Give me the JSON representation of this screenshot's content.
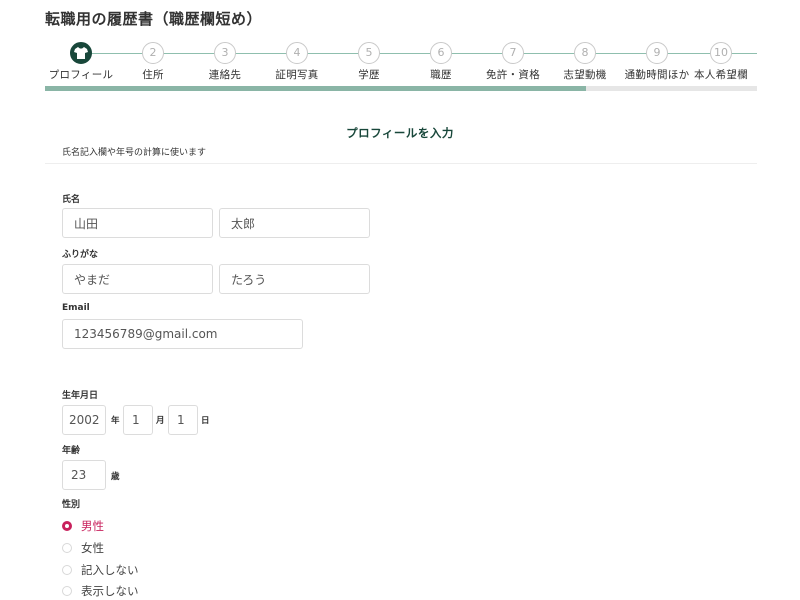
{
  "page": {
    "title": "転職用の履歴書（職歴欄短め）"
  },
  "stepper": {
    "progress_percent": 76,
    "steps": [
      {
        "num": "",
        "label": "プロフィール",
        "active": true
      },
      {
        "num": "2",
        "label": "住所"
      },
      {
        "num": "3",
        "label": "連絡先"
      },
      {
        "num": "4",
        "label": "証明写真"
      },
      {
        "num": "5",
        "label": "学歴"
      },
      {
        "num": "6",
        "label": "職歴"
      },
      {
        "num": "7",
        "label": "免許・資格"
      },
      {
        "num": "8",
        "label": "志望動機"
      },
      {
        "num": "9",
        "label": "通勤時間ほか"
      },
      {
        "num": "10",
        "label": "本人希望欄"
      }
    ]
  },
  "section": {
    "title": "プロフィールを入力",
    "subtitle": "氏名記入欄や年号の計算に使います"
  },
  "form": {
    "name_label": "氏名",
    "last_name": "山田",
    "first_name": "太郎",
    "furigana_label": "ふりがな",
    "last_name_kana": "やまだ",
    "first_name_kana": "たろう",
    "email_label": "Email",
    "email": "123456789@gmail.com",
    "birth_label": "生年月日",
    "birth_year": "2002",
    "year_unit": "年",
    "birth_month": "1",
    "month_unit": "月",
    "birth_day": "1",
    "day_unit": "日",
    "age_label": "年齢",
    "age": "23",
    "age_unit": "歳",
    "gender_label": "性別",
    "gender_options": [
      {
        "label": "男性",
        "checked": true
      },
      {
        "label": "女性",
        "checked": false
      },
      {
        "label": "記入しない",
        "checked": false
      },
      {
        "label": "表示しない",
        "checked": false
      }
    ]
  },
  "colors": {
    "primary": "#18473a",
    "progress": "#8ab5a6",
    "accent": "#c8215c"
  }
}
